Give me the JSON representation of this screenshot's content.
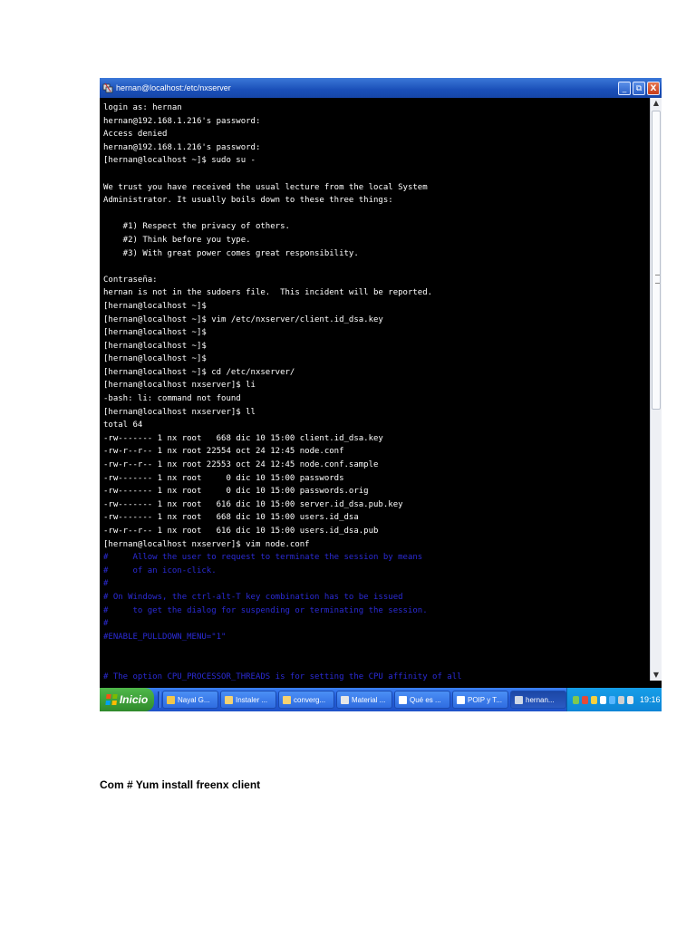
{
  "window": {
    "title": "hernan@localhost:/etc/nxserver",
    "minimize_label": "_",
    "restore_label": "⧉",
    "close_label": "X"
  },
  "terminal": {
    "lines": [
      {
        "text": "login as: hernan",
        "type": "normal"
      },
      {
        "text": "hernan@192.168.1.216's password:",
        "type": "normal"
      },
      {
        "text": "Access denied",
        "type": "normal"
      },
      {
        "text": "hernan@192.168.1.216's password:",
        "type": "normal"
      },
      {
        "text": "[hernan@localhost ~]$ sudo su -",
        "type": "normal"
      },
      {
        "text": "",
        "type": "normal"
      },
      {
        "text": "We trust you have received the usual lecture from the local System",
        "type": "normal"
      },
      {
        "text": "Administrator. It usually boils down to these three things:",
        "type": "normal"
      },
      {
        "text": "",
        "type": "normal"
      },
      {
        "text": "    #1) Respect the privacy of others.",
        "type": "normal"
      },
      {
        "text": "    #2) Think before you type.",
        "type": "normal"
      },
      {
        "text": "    #3) With great power comes great responsibility.",
        "type": "normal"
      },
      {
        "text": "",
        "type": "normal"
      },
      {
        "text": "Contraseña:",
        "type": "normal"
      },
      {
        "text": "hernan is not in the sudoers file.  This incident will be reported.",
        "type": "normal"
      },
      {
        "text": "[hernan@localhost ~]$",
        "type": "normal"
      },
      {
        "text": "[hernan@localhost ~]$ vim /etc/nxserver/client.id_dsa.key",
        "type": "normal"
      },
      {
        "text": "[hernan@localhost ~]$",
        "type": "normal"
      },
      {
        "text": "[hernan@localhost ~]$",
        "type": "normal"
      },
      {
        "text": "[hernan@localhost ~]$",
        "type": "normal"
      },
      {
        "text": "[hernan@localhost ~]$ cd /etc/nxserver/",
        "type": "normal"
      },
      {
        "text": "[hernan@localhost nxserver]$ li",
        "type": "normal"
      },
      {
        "text": "-bash: li: command not found",
        "type": "normal"
      },
      {
        "text": "[hernan@localhost nxserver]$ ll",
        "type": "normal"
      },
      {
        "text": "total 64",
        "type": "normal"
      },
      {
        "text": "-rw------- 1 nx root   668 dic 10 15:00 client.id_dsa.key",
        "type": "normal"
      },
      {
        "text": "-rw-r--r-- 1 nx root 22554 oct 24 12:45 node.conf",
        "type": "normal"
      },
      {
        "text": "-rw-r--r-- 1 nx root 22553 oct 24 12:45 node.conf.sample",
        "type": "normal"
      },
      {
        "text": "-rw------- 1 nx root     0 dic 10 15:00 passwords",
        "type": "normal"
      },
      {
        "text": "-rw------- 1 nx root     0 dic 10 15:00 passwords.orig",
        "type": "normal"
      },
      {
        "text": "-rw------- 1 nx root   616 dic 10 15:00 server.id_dsa.pub.key",
        "type": "normal"
      },
      {
        "text": "-rw------- 1 nx root   668 dic 10 15:00 users.id_dsa",
        "type": "normal"
      },
      {
        "text": "-rw-r--r-- 1 nx root   616 dic 10 15:00 users.id_dsa.pub",
        "type": "normal"
      },
      {
        "text": "[hernan@localhost nxserver]$ vim node.conf",
        "type": "normal"
      },
      {
        "text": "#     Allow the user to request to terminate the session by means",
        "type": "comment"
      },
      {
        "text": "#     of an icon-click.",
        "type": "comment"
      },
      {
        "text": "#",
        "type": "comment"
      },
      {
        "text": "# On Windows, the ctrl-alt-T key combination has to be issued",
        "type": "comment"
      },
      {
        "text": "#     to get the dialog for suspending or terminating the session.",
        "type": "comment"
      },
      {
        "text": "#",
        "type": "comment"
      },
      {
        "text": "#ENABLE_PULLDOWN_MENU=\"1\"",
        "type": "comment"
      },
      {
        "text": "",
        "type": "comment"
      },
      {
        "text": "",
        "type": "comment"
      },
      {
        "text": "# The option CPU_PROCESSOR_THREADS is for setting the CPU affinity of all",
        "type": "comment"
      }
    ]
  },
  "scrollbar": {
    "up_arrow": "▲",
    "down_arrow": "▼",
    "position_fraction": 0.0
  },
  "taskbar": {
    "start_label": "Inicio",
    "buttons": [
      {
        "label": "Nayal G...",
        "icon": "browser-icon",
        "color": "#f2c64a",
        "active": false
      },
      {
        "label": "Instaler ...",
        "icon": "folder-icon",
        "color": "#f5d272",
        "active": false
      },
      {
        "label": "converg...",
        "icon": "folder-icon",
        "color": "#f5d272",
        "active": false
      },
      {
        "label": "Material ...",
        "icon": "document-icon",
        "color": "#e6e6e6",
        "active": false
      },
      {
        "label": "Qué es ...",
        "icon": "word-icon",
        "color": "#ffffff",
        "active": false
      },
      {
        "label": "POIP y T...",
        "icon": "word-icon",
        "color": "#ffffff",
        "active": false
      },
      {
        "label": "hernan...",
        "icon": "putty-icon",
        "color": "#cfd8e6",
        "active": true
      }
    ],
    "clock": "19:16"
  },
  "caption": "Com # Yum install freenx client"
}
